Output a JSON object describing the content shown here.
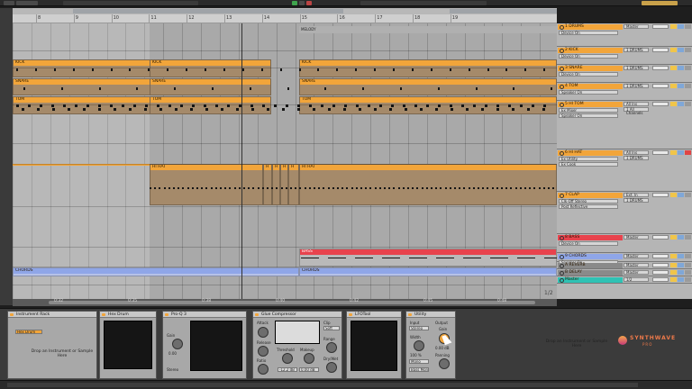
{
  "ruler": {
    "bars": [
      "8",
      "9",
      "10",
      "11",
      "12",
      "13",
      "14",
      "15",
      "16",
      "17",
      "18",
      "19"
    ]
  },
  "arrangement": {
    "marker": "MELODY",
    "clips": {
      "kick": "KICK",
      "snare": "SNARE",
      "tom": "TOM",
      "hihat": "HI HAT",
      "hihat_short": "H",
      "bass": "BASS",
      "chords": "CHORDS"
    }
  },
  "timeline": {
    "times": [
      "0:32",
      "0:35",
      "0:38",
      "0:40",
      "0:42",
      "0:45",
      "0:48"
    ],
    "zoom": "1/2"
  },
  "tracks": [
    {
      "name": "1 DRUMS",
      "device": "Device On",
      "mix": "Master",
      "color": "#f2a53a"
    },
    {
      "name": "2 KICK",
      "device": "Device On",
      "mix": "1 DRUMS",
      "color": "#f2a53a"
    },
    {
      "name": "3 SNARE",
      "device": "Device On",
      "mix": "1 DRUMS",
      "color": "#f2a53a"
    },
    {
      "name": "4 TOM",
      "device": "Speaker On",
      "mix": "1 DRUMS",
      "color": "#f2a53a"
    },
    {
      "name": "5 HI TOM",
      "device": "Ex Mixer",
      "device2": "Speaker On",
      "mix": "All Ins",
      "mix2": "1 All Channels",
      "color": "#f2a53a"
    },
    {
      "name": "6 HI HAT",
      "device": "Ex Utility",
      "device2": "Ex Cook",
      "mix": "All Ins",
      "mix2": "1 DRUMS",
      "color": "#f2a53a"
    },
    {
      "name": "7 CLAP",
      "device": "Clk-Off Stereo",
      "device2": "Post Reflective",
      "mix": "Ext. In",
      "mix2": "1 DRUMS",
      "color": "#f2a53a"
    },
    {
      "name": "8 BASS",
      "device": "Device On",
      "mix": "Master",
      "color": "#e8434d"
    },
    {
      "name": "9 CHORDS",
      "device": "Speaker On",
      "mix": "Master",
      "color": "#8fa6e8"
    },
    {
      "name": "A REVERB",
      "mix": "Master",
      "color": "#8a8a8a"
    },
    {
      "name": "B DELAY",
      "mix": "Master",
      "color": "#8a8a8a"
    },
    {
      "name": "Master",
      "mix": "1/2",
      "color": "#2fc2b4"
    }
  ],
  "devices": {
    "rack": {
      "title": "Instrument Rack",
      "drop": "Drop an Instrument or Sample Here",
      "chain": "Hex Drum"
    },
    "hex": {
      "title": "Hex Drum"
    },
    "proq": {
      "title": "Pro-Q 3",
      "knob1": "Gain",
      "val1": "0.00",
      "mode": "Stereo"
    },
    "glue": {
      "title": "Glue Compressor",
      "attack": "Attack",
      "release": "Release",
      "ratio": "Ratio",
      "threshold": "Threshold",
      "makeup": "Makeup",
      "range": "Range",
      "dry_wet": "Dry/Wet",
      "clip": "Clip",
      "soft": "Soft",
      "sidechain": "Sidechain",
      "thr_val": "-12.2 dB",
      "mk_val": "0.00 dB"
    },
    "lfo": {
      "title": "LFOTool"
    },
    "utility": {
      "title": "Utility",
      "input": "Input",
      "output": "Output",
      "gain": "Gain",
      "width": "Width",
      "panning": "Panning",
      "mono": "Mono",
      "stereo": "Stereo",
      "bass_mono": "Bass Mono",
      "gain_val": "0.00 dB",
      "width_val": "100 %"
    },
    "drop_right": "Drop an Instrument or Sample Here"
  },
  "logo": {
    "name": "SYNTHWAVE",
    "sub": "PRO"
  },
  "colors": {
    "drums": "#f2a53a",
    "bass": "#e8434d",
    "chords": "#8fa6e8",
    "master": "#2fc2b4"
  }
}
